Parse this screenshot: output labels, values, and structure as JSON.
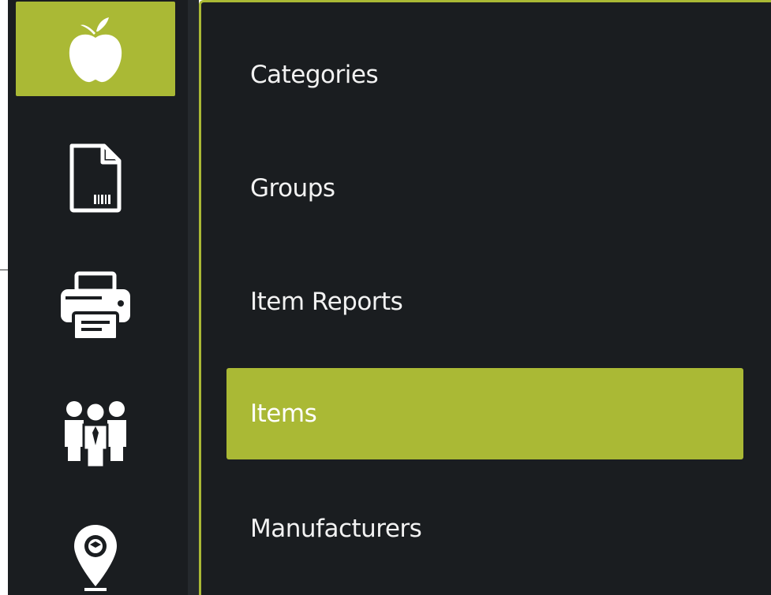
{
  "theme": {
    "accent": "#aab935",
    "panel_bg": "#1a1d20",
    "text": "#f2f2f2"
  },
  "rail": {
    "items": [
      {
        "icon": "apple-icon",
        "active": true
      },
      {
        "icon": "barcode-document-icon",
        "active": false
      },
      {
        "icon": "printer-icon",
        "active": false
      },
      {
        "icon": "people-group-icon",
        "active": false
      },
      {
        "icon": "location-pin-icon",
        "active": false
      }
    ]
  },
  "submenu": {
    "items": [
      {
        "label": "Categories",
        "selected": false
      },
      {
        "label": "Groups",
        "selected": false
      },
      {
        "label": "Item Reports",
        "selected": false
      },
      {
        "label": "Items",
        "selected": true
      },
      {
        "label": "Manufacturers",
        "selected": false
      }
    ]
  }
}
